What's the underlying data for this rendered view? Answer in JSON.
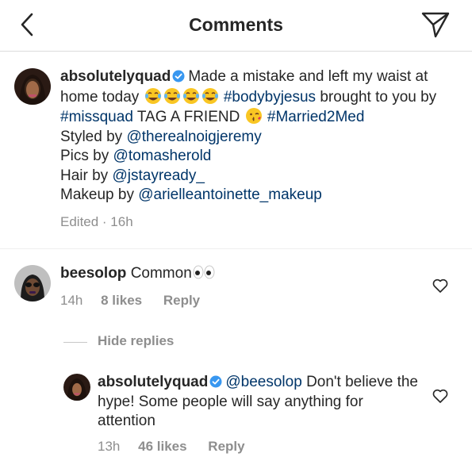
{
  "header": {
    "title": "Comments",
    "back_icon": "chevron-left-icon",
    "share_icon": "send-icon"
  },
  "caption": {
    "username": "absolutelyquad",
    "verified": true,
    "text1": "Made a mistake and left my waist at home today",
    "emoji_laugh_count": 4,
    "hashtag1": "#bodybyjesus",
    "text2": "brought to you by",
    "hashtag2": "#missquad",
    "text3": "TAG A FRIEND",
    "emoji_kiss": "kissing-face-emoji",
    "hashtag3": "#Married2Med",
    "styled_label": "Styled by",
    "styled_handle": "@therealnoigjeremy",
    "pics_label": "Pics by",
    "pics_handle": "@tomasherold",
    "hair_label": "Hair by",
    "hair_handle": "@jstayready_",
    "makeup_label": "Makeup by",
    "makeup_handle": "@arielleantoinette_makeup",
    "meta": "Edited · 16h"
  },
  "comment1": {
    "username": "beesolop",
    "text": "Common",
    "emoji": "eyes-emoji",
    "time": "14h",
    "likes": "8 likes",
    "reply": "Reply"
  },
  "hide_replies": "Hide replies",
  "reply1": {
    "username": "absolutelyquad",
    "verified": true,
    "mention": "@beesolop",
    "text": "Don't believe the hype! Some people will say anything for attention",
    "time": "13h",
    "likes": "46 likes",
    "reply": "Reply"
  },
  "colors": {
    "link": "#003569",
    "meta": "#8e8e8e",
    "verified": "#3897f0",
    "text": "#262626"
  }
}
